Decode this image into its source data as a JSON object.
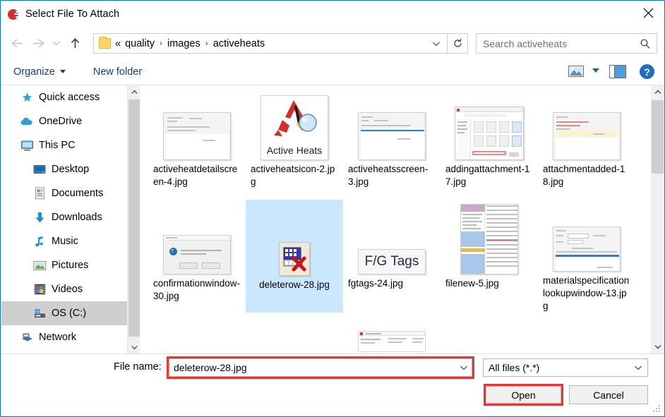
{
  "window": {
    "title": "Select File To Attach",
    "icon": "app-globe-icon",
    "close_label": "✕",
    "border_color": "#0078d7"
  },
  "nav": {
    "back_label": "←",
    "forward_label": "→",
    "recent_label": "⌄",
    "up_label": "↑",
    "refresh_label": "⟳"
  },
  "address": {
    "prefix": "«",
    "crumbs": [
      "quality",
      "images",
      "activeheats"
    ],
    "separator": "›",
    "chevron": "⌄"
  },
  "search": {
    "placeholder": "Search activeheats"
  },
  "toolbar": {
    "organize_label": "Organize",
    "new_folder_label": "New folder",
    "help_label": "?"
  },
  "sidebar": {
    "items": [
      {
        "label": "Quick access",
        "icon": "star-icon",
        "indent": 0,
        "selected": false
      },
      {
        "label": "OneDrive",
        "icon": "cloud-icon",
        "indent": 0,
        "selected": false
      },
      {
        "label": "This PC",
        "icon": "monitor-icon",
        "indent": 0,
        "selected": false
      },
      {
        "label": "Desktop",
        "icon": "desktop-icon",
        "indent": 1,
        "selected": false
      },
      {
        "label": "Documents",
        "icon": "document-icon",
        "indent": 1,
        "selected": false
      },
      {
        "label": "Downloads",
        "icon": "download-arrow-icon",
        "indent": 1,
        "selected": false
      },
      {
        "label": "Music",
        "icon": "music-note-icon",
        "indent": 1,
        "selected": false
      },
      {
        "label": "Pictures",
        "icon": "picture-icon",
        "indent": 1,
        "selected": false
      },
      {
        "label": "Videos",
        "icon": "video-film-icon",
        "indent": 1,
        "selected": false
      },
      {
        "label": "OS (C:)",
        "icon": "drive-icon",
        "indent": 1,
        "selected": true
      },
      {
        "label": "Network",
        "icon": "network-icon",
        "indent": 0,
        "selected": false
      }
    ]
  },
  "files": [
    {
      "name": "activeheatdetailscreen-4.jpg",
      "thumb": "doc",
      "selected": false
    },
    {
      "name": "activeheatsicon-2.jpg",
      "thumb": "activeheats-logo",
      "selected": false
    },
    {
      "name": "activeheatsscreen-3.jpg",
      "thumb": "doc-blueline",
      "selected": false
    },
    {
      "name": "addingattachment-17.jpg",
      "thumb": "explorer",
      "selected": false
    },
    {
      "name": "attachmentadded-18.jpg",
      "thumb": "doc-yellow",
      "selected": false
    },
    {
      "name": "confirmationwindow-30.jpg",
      "thumb": "dialog",
      "selected": false
    },
    {
      "name": "deleterow-28.jpg",
      "thumb": "deleterow-icon",
      "selected": true
    },
    {
      "name": "fgtags-24.jpg",
      "thumb": "fgtags",
      "selected": false
    },
    {
      "name": "filenew-5.jpg",
      "thumb": "listing",
      "selected": false
    },
    {
      "name": "materialspecificationlookupwindow-13.jpg",
      "thumb": "doc-blueline",
      "selected": false
    }
  ],
  "thumbnail_text": {
    "activeheats_logo": "Active Heats",
    "fgtags": "F/G Tags"
  },
  "footer": {
    "filename_label": "File name:",
    "filename_value": "deleterow-28.jpg",
    "filetype_value": "All files (*.*)",
    "open_label": "Open",
    "cancel_label": "Cancel",
    "caret": "⌄"
  },
  "highlights": {
    "color": "#ee3333",
    "targets": [
      "filename-input",
      "open-button"
    ]
  },
  "selection_color": "#cce8ff"
}
